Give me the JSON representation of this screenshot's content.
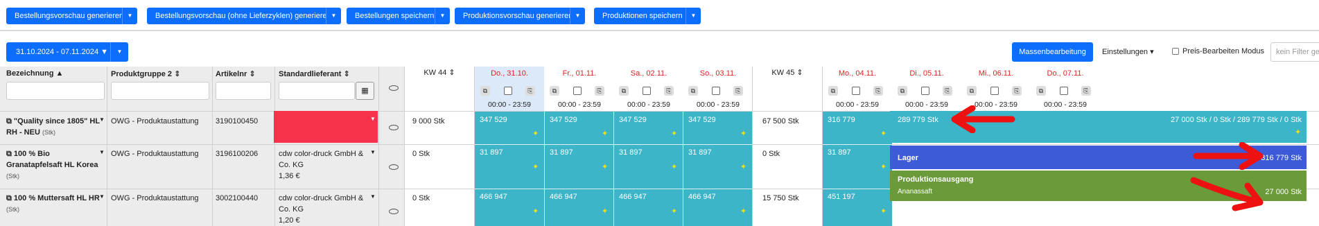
{
  "toolbar": {
    "buttons": [
      "Bestellungsvorschau generieren",
      "Bestellungsvorschau (ohne Lieferzyklen) generieren",
      "Bestellungen speichern",
      "Produktionsvorschau generieren",
      "Produktionen speichern"
    ]
  },
  "controls": {
    "date_range": "31.10.2024 - 07.11.2024",
    "mass_edit": "Massenbearbeitung",
    "settings": "Einstellungen",
    "price_edit_mode": "Preis-Bearbeiten Modus",
    "search_placeholder": "kein Filter gesetzt"
  },
  "columns": {
    "name": "Bezeichnung",
    "group": "Produktgruppe 2",
    "article": "Artikelnr",
    "supplier": "Standardlieferant"
  },
  "weeks": {
    "kw44": "KW 44",
    "kw45": "KW 45"
  },
  "days": [
    "Do., 31.10.",
    "Fr., 01.11.",
    "Sa., 02.11.",
    "So., 03.11.",
    "Mo., 04.11.",
    "Di., 05.11.",
    "Mi., 06.11.",
    "Do., 07.11."
  ],
  "time_range": "00:00 - 23:59",
  "rows": [
    {
      "name": "\"Quality since 1805\" HL RH - NEU",
      "unit": "(Stk)",
      "group": "OWG - Produktaustattung",
      "article": "3190100450",
      "supplier": "",
      "supplier_price": "",
      "kw44": "9 000 Stk",
      "kw45": "67 500 Stk",
      "values": [
        "347 529",
        "347 529",
        "347 529",
        "347 529",
        "316 779",
        "289 779 Stk"
      ],
      "summary": "27 000 Stk / 0 Stk / 289 779 Stk / 0 Stk"
    },
    {
      "name": "100 % Bio Granatapfelsaft HL Korea",
      "unit": "(Stk)",
      "group": "OWG - Produktaustattung",
      "article": "3196100206",
      "supplier": "cdw color-druck GmbH & Co. KG",
      "supplier_price": "1,36 €",
      "kw44": "0 Stk",
      "kw45": "0 Stk",
      "values": [
        "31 897",
        "31 897",
        "31 897",
        "31 897",
        "31 897"
      ]
    },
    {
      "name": "100 % Muttersaft HL HR",
      "unit": "(Stk)",
      "group": "OWG - Produktaustattung",
      "article": "3002100440",
      "supplier": "cdw color-druck GmbH & Co. KG",
      "supplier_price": "1,20 €",
      "kw44": "0 Stk",
      "kw45": "15 750 Stk",
      "values": [
        "466 947",
        "466 947",
        "466 947",
        "466 947",
        "451 197"
      ]
    }
  ],
  "tooltip": {
    "lager_label": "Lager",
    "lager_value": "316 779 Stk",
    "prod_label": "Produktionsausgang",
    "prod_sub": "Ananassaft",
    "prod_value": "27 000 Stk"
  },
  "colors": {
    "primary": "#0d6efd",
    "teal": "#3db5c8",
    "red_cell": "#f7324c",
    "lager_blue": "#3d5ad8",
    "prod_green": "#6a9a3a"
  }
}
